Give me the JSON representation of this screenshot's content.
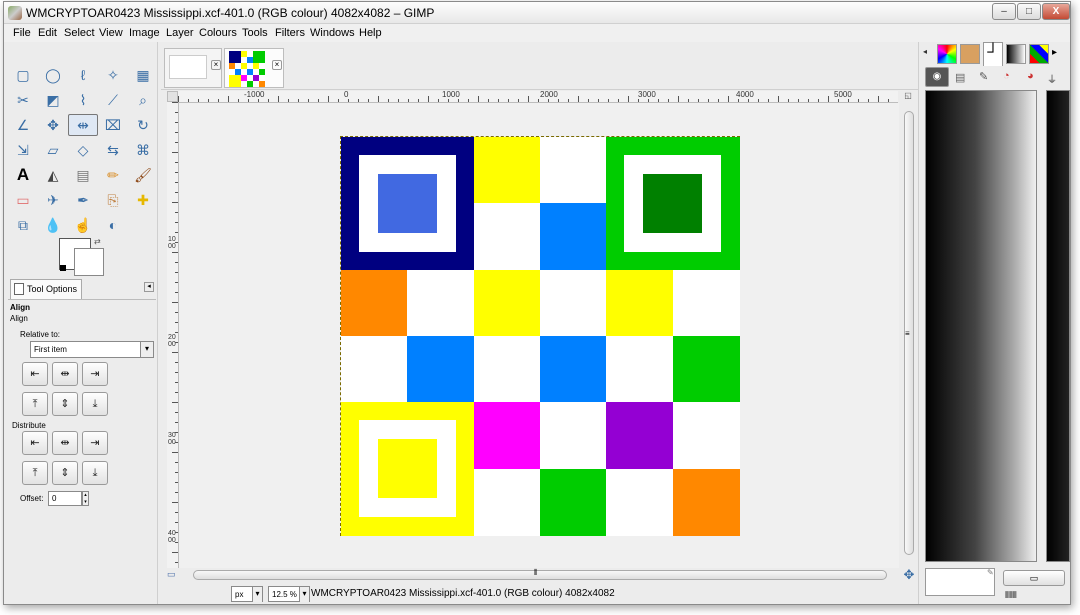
{
  "window": {
    "title": "WMCRYPTOAR0423 Mississippi.xcf-401.0 (RGB colour) 4082x4082 – GIMP",
    "minimize": "–",
    "maximize": "□",
    "close": "X"
  },
  "menu": [
    "File",
    "Edit",
    "Select",
    "View",
    "Image",
    "Layer",
    "Colours",
    "Tools",
    "Filters",
    "Windows",
    "Help"
  ],
  "toolbox": {
    "tools": [
      "rect-select",
      "ellipse-select",
      "free-select",
      "fuzzy-select",
      "select-by-color",
      "scissors",
      "foreground-select",
      "paths",
      "color-picker",
      "zoom",
      "measure",
      "move",
      "align",
      "crop",
      "rotate",
      "scale",
      "shear",
      "perspective",
      "flip",
      "cage",
      "text",
      "bucket-fill",
      "blend",
      "pencil",
      "paintbrush",
      "eraser",
      "airbrush",
      "ink",
      "clone",
      "heal",
      "perspective-clone",
      "blur",
      "smudge",
      "dodge-burn"
    ],
    "selected_tool": "align"
  },
  "tool_options": {
    "tab_label": "Tool Options",
    "heading": "Align",
    "subheading": "Align",
    "relative_to_label": "Relative to:",
    "relative_to_value": "First item",
    "distribute_label": "Distribute",
    "offset_label": "Offset:",
    "offset_value": "0"
  },
  "image_tabs": [
    "blank-image",
    "mississippi-image"
  ],
  "tab_close_glyph": "×",
  "ruler": {
    "h_labels": [
      "-1000",
      "0",
      "1000",
      "2000",
      "3000",
      "4000",
      "5000"
    ],
    "v_labels": [
      "1000",
      "2000",
      "3000",
      "4000"
    ]
  },
  "status": {
    "unit": "px",
    "zoom": "12.5 %",
    "text": "WMCRYPTOAR0423 Mississippi.xcf-401.0 (RGB colour) 4082x4082"
  },
  "colors": {
    "navy": "#000080",
    "royal": "#4169e1",
    "yellow": "#ffff00",
    "white": "#ffffff",
    "azure": "#0080ff",
    "green": "#00cc00",
    "darkgreen": "#008000",
    "orange": "#ff8800",
    "magenta": "#ff00ff",
    "purple": "#9400d3"
  },
  "flag_grid": [
    [
      "navy",
      "navy",
      "yellow",
      "white",
      "green",
      "green"
    ],
    [
      "navy",
      "navy",
      "white",
      "azure",
      "green",
      "green"
    ],
    [
      "orange",
      "white",
      "yellow",
      "white",
      "yellow",
      "white"
    ],
    [
      "white",
      "azure",
      "white",
      "azure",
      "white",
      "green"
    ],
    [
      "yellow",
      "yellow",
      "magenta",
      "white",
      "purple",
      "white"
    ],
    [
      "yellow",
      "yellow",
      "white",
      "green",
      "white",
      "orange"
    ]
  ]
}
